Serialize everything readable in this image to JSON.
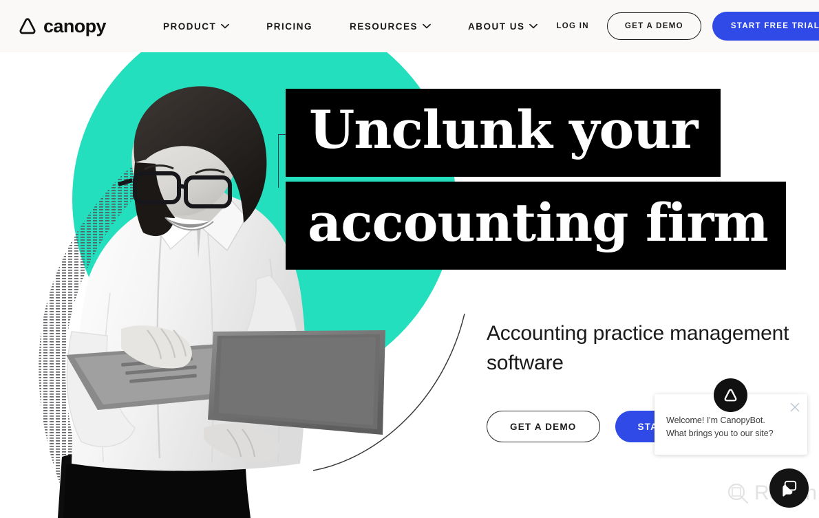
{
  "navbar": {
    "logo_text": "canopy",
    "logo_icon": "canopy-triangle-logo",
    "links": [
      {
        "label": "PRODUCT",
        "has_dropdown": true,
        "icon": "chevron-down-icon"
      },
      {
        "label": "PRICING",
        "has_dropdown": false,
        "icon": ""
      },
      {
        "label": "RESOURCES",
        "has_dropdown": true,
        "icon": "chevron-down-icon"
      },
      {
        "label": "ABOUT US",
        "has_dropdown": true,
        "icon": "chevron-down-icon"
      }
    ],
    "login_label": "LOG IN",
    "demo_label": "GET A DEMO",
    "trial_label": "START FREE TRIAL",
    "background_color": "#faf9f7"
  },
  "hero": {
    "headline_line1": "Unclunk your",
    "headline_line2": "accounting firm",
    "subheadline": "Accounting practice management software",
    "cta_demo_label": "GET A DEMO",
    "cta_trial_label": "START FREE TRIAL",
    "accent_teal": "#24dfbd",
    "accent_blue": "#2f4ae6",
    "headline_block_color": "#000000",
    "photo_alt": "woman-with-laptop-photo"
  },
  "chat": {
    "message": "Welcome! I'm CanopyBot. What brings you to our site?",
    "close_icon": "close-icon",
    "avatar_icon": "canopybot-avatar-icon",
    "launcher_icon": "chat-bubble-icon"
  },
  "watermark": {
    "text": "Revain",
    "icon": "revain-logo-icon",
    "color": "#e2e2e2"
  }
}
